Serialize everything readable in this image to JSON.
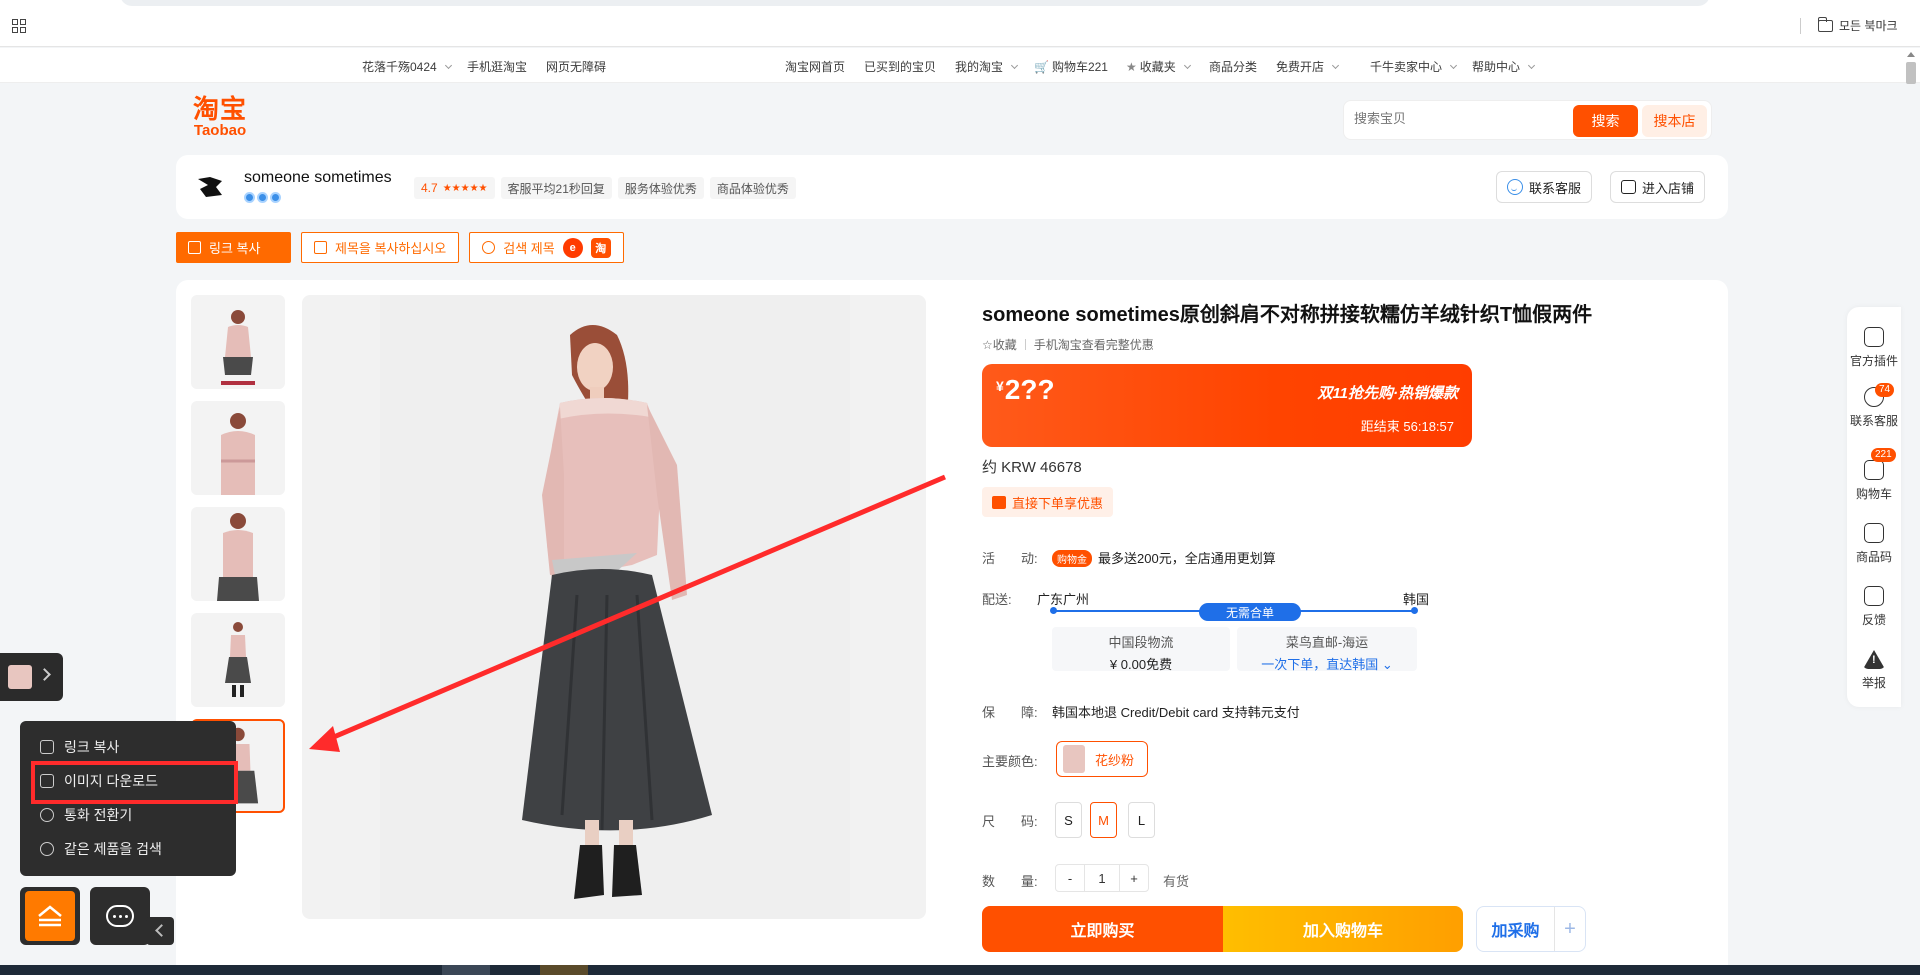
{
  "browser": {
    "bookmarks_folder": "모든 북마크"
  },
  "site_nav": {
    "user": "花落千殇0424",
    "mobile": "手机逛淘宝",
    "accessibility": "网页无障碍",
    "home": "淘宝网首页",
    "bought": "已买到的宝贝",
    "my_taobao": "我的淘宝",
    "cart": "购物车221",
    "favorites": "收藏夹",
    "categories": "商品分类",
    "open_store": "免费开店",
    "seller_center": "千牛卖家中心",
    "help": "帮助中心"
  },
  "header": {
    "logo_cn": "淘宝",
    "logo_en": "Taobao",
    "search_placeholder": "搜索宝贝",
    "search_button": "搜索",
    "search_store_button": "搜本店"
  },
  "shop": {
    "name": "someone sometimes",
    "rating": "4.7",
    "stars": "★★★★★",
    "tags": [
      "客服平均21秒回复",
      "服务体验优秀",
      "商品体验优秀"
    ],
    "contact_button": "联系客服",
    "enter_store_button": "进入店铺"
  },
  "ext_toolbar": {
    "copy_link": "링크 복사",
    "copy_title": "제목을 복사하십시오",
    "search_title": "검색 제목",
    "mini1": "e",
    "mini2": "淘"
  },
  "product": {
    "title": "someone sometimes原创斜肩不对称拼接软糯仿羊绒针织T恤假两件",
    "favorite": "收藏",
    "mobile_promo": "手机淘宝查看完整优惠",
    "currency": "¥",
    "price": "2??",
    "promo_title": "双11抢先购·热销爆款",
    "countdown": "距结束 56:18:57",
    "krw": "约 KRW 46678",
    "coupon": "直接下单享优惠",
    "activity_label": "活　　动:",
    "activity_badge": "购物金",
    "activity_text": "最多送200元，全店通用更划算",
    "shipping_label": "配送:",
    "ship_from": "广东广州",
    "ship_to": "韩国",
    "ship_chip": "无需合单",
    "ship_a_title": "中国段物流",
    "ship_a_value": "¥ 0.00免费",
    "ship_b_title": "菜鸟直邮-海运",
    "ship_b_value": "一次下单，直达韩国",
    "guarantee_label": "保　　障:",
    "guarantee_text": "韩国本地退 Credit/Debit card 支持韩元支付",
    "color_label": "主要颜色:",
    "color_option": "花纱粉",
    "size_label": "尺　　码:",
    "sizes": [
      "S",
      "M",
      "L"
    ],
    "selected_size": "M",
    "qty_label": "数　　量:",
    "qty_minus": "-",
    "qty_value": "1",
    "qty_plus": "+",
    "stock": "有货",
    "buy_now": "立即购买",
    "add_cart": "加入购物车",
    "purchase": "加采购",
    "purchase_plus": "+"
  },
  "side_tools": {
    "plugin": "官方插件",
    "service": "联系客服",
    "service_badge": "74",
    "cart": "购物车",
    "cart_badge": "221",
    "qrcode": "商品码",
    "feedback": "反馈",
    "report": "举报"
  },
  "ext_menu": {
    "copy_link": "링크 복사",
    "download_image": "이미지 다운로드",
    "currency": "통화 전환기",
    "search_same": "같은 제품을 검색"
  },
  "colors": {
    "brand": "#ff5000",
    "ext_orange": "#ff6a00",
    "blue": "#1f6fe8",
    "highlight": "#ff2b2b"
  }
}
